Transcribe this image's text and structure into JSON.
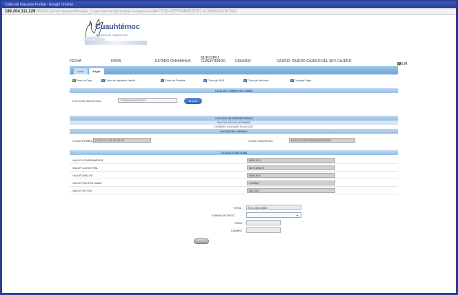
{
  "window": {
    "title": "Cobro de Impuesto Predial - Google Chrome",
    "address_host": "189.204.111.229",
    "address_path": ":8080/CobroImpuestoPredial_Cuauhtemoc/principal.xsl;jsessionid=C53C4EEF98B65DFECAC8668A376C842"
  },
  "header": {
    "logo_text": "Cuauhtémoc",
    "logo_subtext": "Municipio de Cuauhtémoc",
    "fecha_label": "FECHA",
    "hora_label": "HORA",
    "estado": "ESTADO CHIHUAHUA",
    "municipio": "MUNICIPIO CUAUHTÉMOC",
    "usuario_label": "USUARIO",
    "usuario_value": "CAJERO CAJERO CAJERO DEL SEV. CAJERO",
    "salir": "SALIR"
  },
  "tabs": [
    {
      "label": "Inicio"
    },
    {
      "label": "Pagar"
    }
  ],
  "toolbar": [
    {
      "label": "Pase de Caja",
      "icon": "list-icon"
    },
    {
      "label": "Cobro de Impuesto Predial",
      "icon": "document-icon"
    },
    {
      "label": "Cobro de Trámites",
      "icon": "document-icon"
    },
    {
      "label": "Cobro de ISAB",
      "icon": "document-icon"
    },
    {
      "label": "Cobro de Servicios",
      "icon": "document-icon"
    },
    {
      "label": "Cancelar Pago",
      "icon": "document-icon"
    }
  ],
  "caja": {
    "title": "CAJA DE COBRO DEL ISABI",
    "folio_label": "FOLIO DE SOLICITUD",
    "folio_value": "17000000000000113",
    "buscar": "Buscar"
  },
  "propietarios": {
    "title": "LISTADO DE PROPIETARIOS",
    "header": "RAZON SOCIAL/NOMBRE",
    "row": "GABRIEL AGUILAR VILLEGAS"
  },
  "predio": {
    "title": "DATOS DEL PREDIO",
    "cuenta_label": "CUENTA PREDIAL",
    "cuenta_value": "0-5-57-1-1-45-25-30-01",
    "clave_label": "CLAVE CATASTRAL",
    "clave_value": "02001017230005025023010000"
  },
  "calculo": {
    "title": "CÁLCULO DE ISABI",
    "rows": [
      {
        "label": "VALOR COMPRAVENTA",
        "value": "$600,000"
      },
      {
        "label": "VALOR CATASTRAL",
        "value": "$274,656.75"
      },
      {
        "label": "VALOR AVALÚO",
        "value": "$550,000"
      },
      {
        "label": "VALOR FACTOR ISABI",
        "value": "2.00000"
      },
      {
        "label": "VALOR DE ISAI",
        "value": "$11,000"
      }
    ]
  },
  "pago": {
    "total_label": "TOTAL",
    "total_value": "$ 11,000.00000",
    "forma_label": "FORMA DE PAGO",
    "forma_value": "",
    "pago_label": "PAGO",
    "pago_value": "",
    "cambio_label": "CAMBIO",
    "cambio_value": ""
  }
}
